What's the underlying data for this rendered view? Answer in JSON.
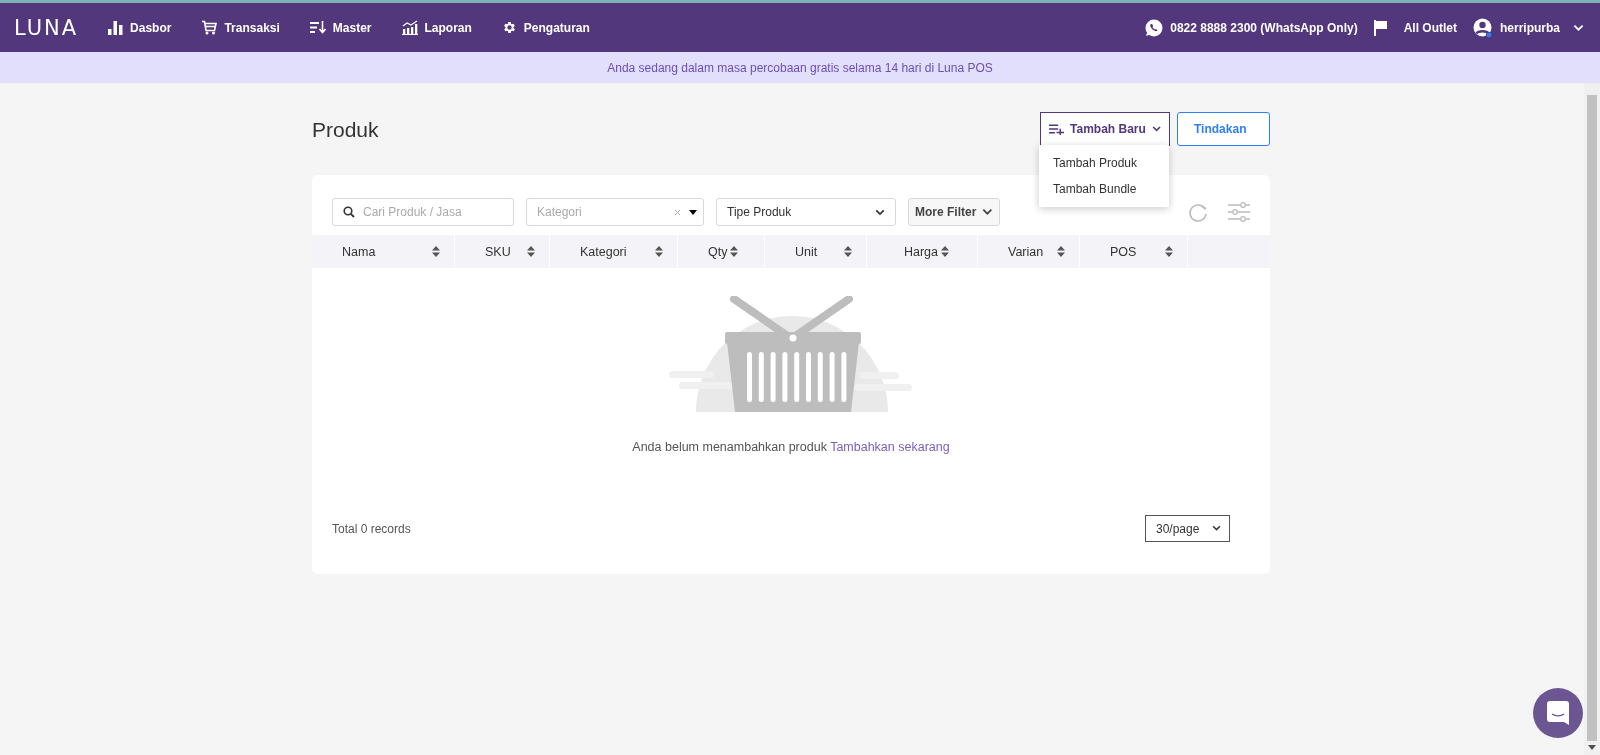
{
  "navbar": {
    "logo": "LUNA",
    "items": [
      {
        "label": "Dasbor"
      },
      {
        "label": "Transaksi"
      },
      {
        "label": "Master"
      },
      {
        "label": "Laporan"
      },
      {
        "label": "Pengaturan"
      }
    ],
    "phone": "0822 8888 2300 (WhatsApp Only)",
    "outlet": "All Outlet",
    "user": "herripurba"
  },
  "banner": "Anda sedang dalam masa percobaan gratis selama 14 hari di Luna POS",
  "page": {
    "title": "Produk",
    "add_button": {
      "label": "Tambah Baru",
      "expanded": true,
      "menu": [
        "Tambah Produk",
        "Tambah Bundle"
      ]
    },
    "actions_button": "Tindakan",
    "filters": {
      "search_placeholder": "Cari Produk / Jasa",
      "category_placeholder": "Kategori",
      "product_type": "Tipe Produk",
      "more_filter": "More Filter"
    },
    "table": {
      "columns": [
        {
          "label": "Nama",
          "kind": "text"
        },
        {
          "label": "SKU",
          "kind": "text"
        },
        {
          "label": "Kategori",
          "kind": "text"
        },
        {
          "label": "Qty",
          "kind": "number"
        },
        {
          "label": "Unit",
          "kind": "text"
        },
        {
          "label": "Harga",
          "kind": "number"
        },
        {
          "label": "Varian",
          "kind": "text"
        },
        {
          "label": "POS",
          "kind": "text"
        }
      ]
    },
    "empty": {
      "message": "Anda belum menambahkan produk",
      "link": "Tambahkan sekarang"
    },
    "total": "Total 0 records",
    "page_size": "30/page"
  }
}
